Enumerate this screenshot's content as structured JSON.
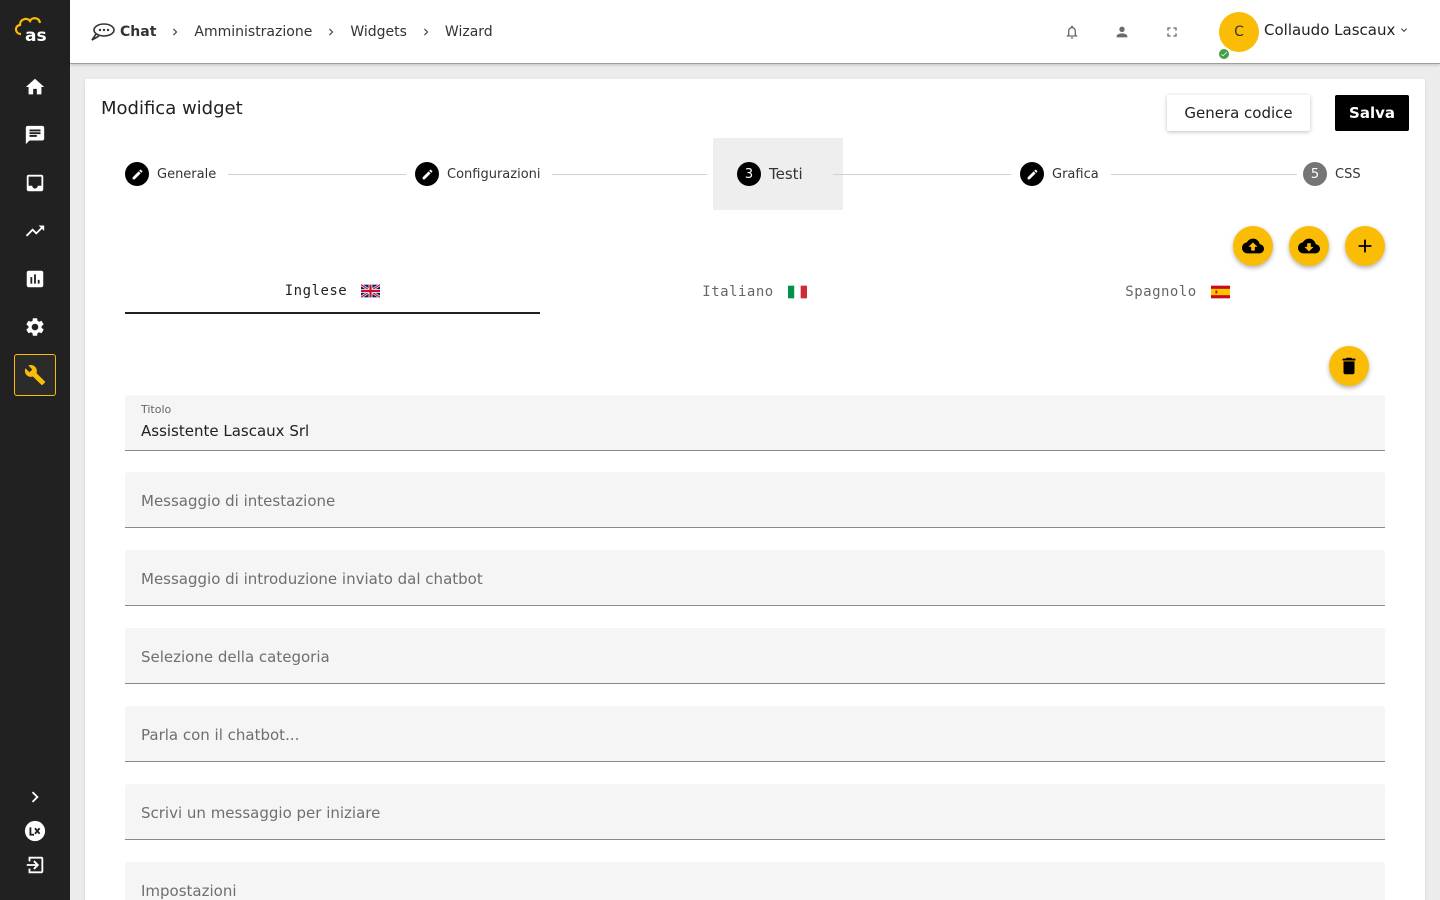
{
  "sidebar": {
    "logo_text": "as",
    "items": [
      {
        "name": "home",
        "icon": "home-icon",
        "active": false
      },
      {
        "name": "chat",
        "icon": "chat-icon",
        "active": false
      },
      {
        "name": "inbox",
        "icon": "inbox-icon",
        "active": false
      },
      {
        "name": "trending",
        "icon": "trending-up-icon",
        "active": false
      },
      {
        "name": "analytics",
        "icon": "bar-chart-icon",
        "active": false
      },
      {
        "name": "settings",
        "icon": "gear-icon",
        "active": false
      },
      {
        "name": "tools",
        "icon": "wrench-icon",
        "active": true
      }
    ],
    "bottom": [
      "chevron-right-icon",
      "lx-logo-icon",
      "logout-icon"
    ],
    "accent_color": "#fbbc05"
  },
  "header": {
    "breadcrumbs": [
      "Chat",
      "Amministrazione",
      "Widgets",
      "Wizard"
    ],
    "avatar_initial": "C",
    "user_name": "Collaudo Lascaux",
    "status_color": "#43a047",
    "icons": [
      "bell-icon",
      "person-icon",
      "fullscreen-icon"
    ]
  },
  "page": {
    "title": "Modifica widget",
    "generate_code_label": "Genera codice",
    "save_label": "Salva"
  },
  "stepper": {
    "steps": [
      {
        "label": "Generale",
        "state": "edit"
      },
      {
        "label": "Configurazioni",
        "state": "edit"
      },
      {
        "number": "3",
        "label": "Testi",
        "state": "active"
      },
      {
        "label": "Grafica",
        "state": "edit"
      },
      {
        "number": "5",
        "label": "CSS",
        "state": "pending"
      }
    ]
  },
  "actions": [
    "upload-icon",
    "download-icon",
    "add-icon"
  ],
  "tabs": [
    {
      "label": "Inglese",
      "flag": "uk-flag-icon",
      "active": true
    },
    {
      "label": "Italiano",
      "flag": "it-flag-icon",
      "active": false
    },
    {
      "label": "Spagnolo",
      "flag": "es-flag-icon",
      "active": false
    }
  ],
  "form": {
    "title_label": "Titolo",
    "title_value": "Assistente Lascaux Srl",
    "placeholders": [
      "Messaggio di intestazione",
      "Messaggio di introduzione inviato dal chatbot",
      "Selezione della categoria",
      "Parla con il chatbot...",
      "Scrivi un messaggio per iniziare",
      "Impostazioni"
    ]
  }
}
